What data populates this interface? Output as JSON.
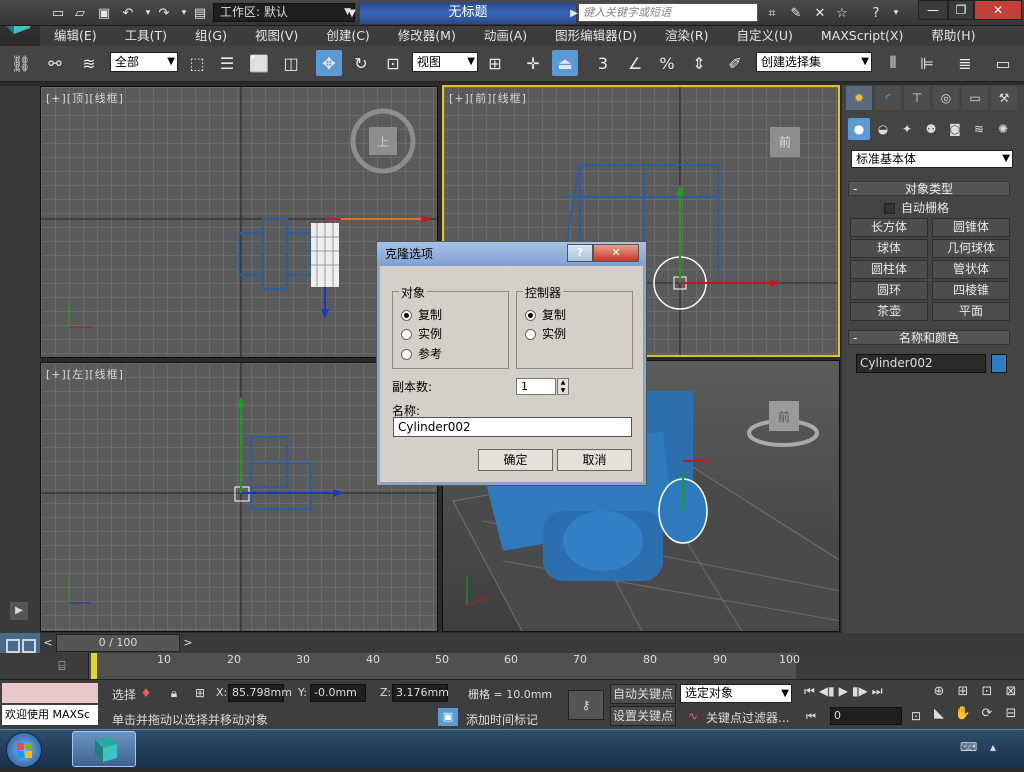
{
  "titlebar": {
    "workspace_label": "工作区: 默认",
    "document_title": "无标题",
    "search_placeholder": "键入关键字或短语"
  },
  "menu": [
    "编辑(E)",
    "工具(T)",
    "组(G)",
    "视图(V)",
    "创建(C)",
    "修改器(M)",
    "动画(A)",
    "图形编辑器(D)",
    "渲染(R)",
    "自定义(U)",
    "MAXScript(X)",
    "帮助(H)"
  ],
  "toolbar": {
    "selection_filter": "全部",
    "reference_coord": "视图",
    "named_selection": "创建选择集",
    "snap_label": "3"
  },
  "viewports": {
    "top": {
      "label": "[+][顶][线框]",
      "cube_face": "上"
    },
    "front": {
      "label": "[+][前][线框]",
      "cube_face": "前"
    },
    "left": {
      "label": "[+][左][线框]"
    },
    "persp": {
      "cube_face": "前"
    }
  },
  "command_panel": {
    "category_dropdown": "标准基本体",
    "object_type_header": "对象类型",
    "autogrid_label": "自动栅格",
    "buttons": [
      "长方体",
      "圆锥体",
      "球体",
      "几何球体",
      "圆柱体",
      "管状体",
      "圆环",
      "四棱锥",
      "茶壶",
      "平面"
    ],
    "name_color_header": "名称和颜色",
    "object_name": "Cylinder002",
    "object_color": "#2f7fc8"
  },
  "dialog": {
    "title": "克隆选项",
    "object_group": {
      "title": "对象",
      "options": [
        "复制",
        "实例",
        "参考"
      ],
      "selected": "复制"
    },
    "controller_group": {
      "title": "控制器",
      "options": [
        "复制",
        "实例"
      ],
      "selected": "复制"
    },
    "copies_label": "副本数:",
    "copies_value": "1",
    "name_label": "名称:",
    "name_value": "Cylinder002",
    "ok_label": "确定",
    "cancel_label": "取消"
  },
  "timeline": {
    "frame_label": "0 / 100",
    "ticks": [
      "10",
      "20",
      "30",
      "40",
      "50",
      "60",
      "70",
      "80",
      "90",
      "100"
    ]
  },
  "status": {
    "selection_text": "选择",
    "x_label": "X:",
    "x_value": "85.798mm",
    "y_label": "Y:",
    "y_value": "-0.0mm",
    "z_label": "Z:",
    "z_value": "3.176mm",
    "grid_text": "栅格 = 10.0mm",
    "auto_key": "自动关键点",
    "set_key": "设置关键点",
    "key_mode": "选定对象",
    "key_filter": "关键点过滤器...",
    "frame_value": "0",
    "add_time_tag": "添加时间标记",
    "prompt": "单击并拖动以选择并移动对象",
    "welcome": "欢迎使用 MAXSc"
  }
}
